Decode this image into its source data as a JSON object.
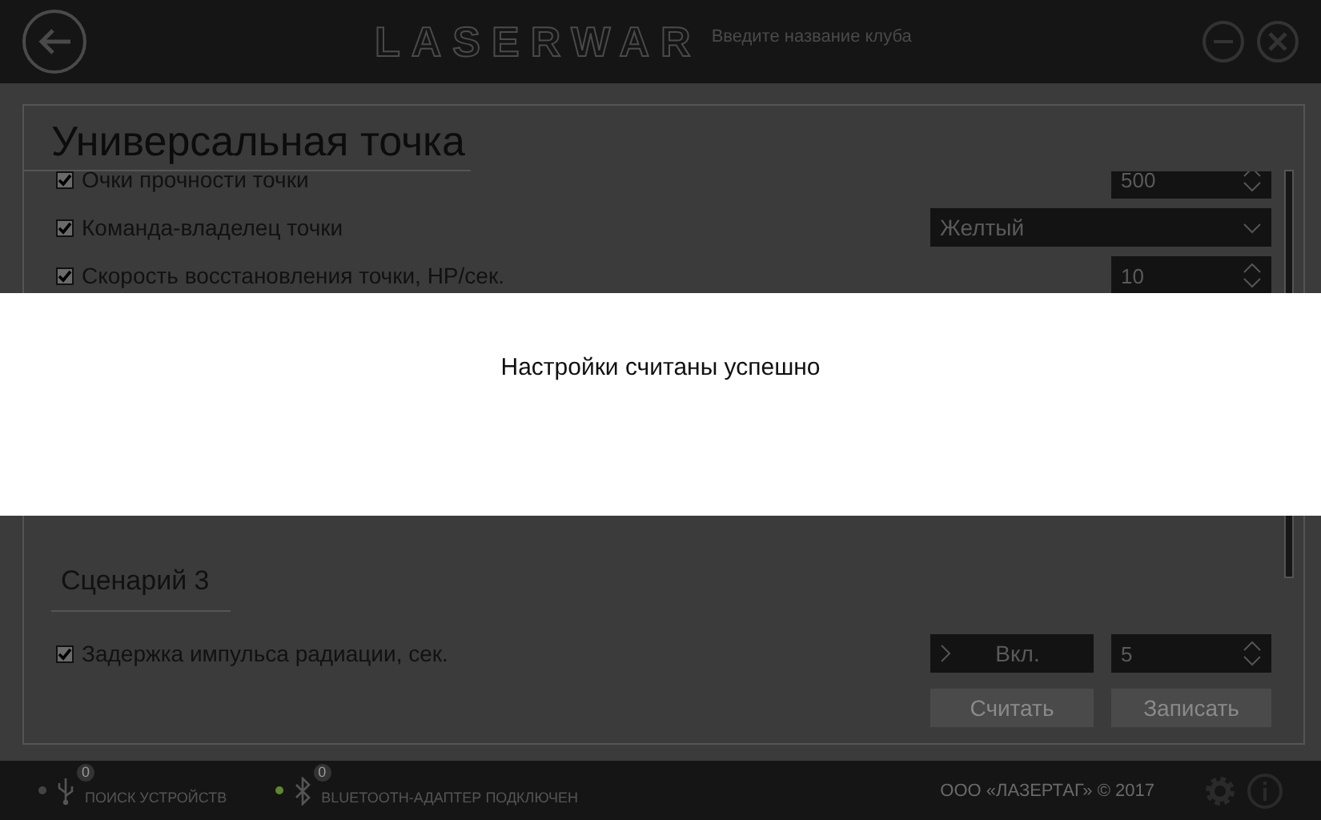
{
  "header": {
    "logo": "LASERWAR",
    "club_field": {
      "placeholder": "Введите название клуба"
    }
  },
  "panel": {
    "title": "Универсальная точка",
    "settings": [
      {
        "kind": "number",
        "label": "Очки прочности точки",
        "checked": true,
        "value": "500"
      },
      {
        "kind": "select",
        "label": "Команда-владелец точки",
        "checked": true,
        "value": "Желтый"
      },
      {
        "kind": "number",
        "label": "Скорость восстановления точки, HP/сек.",
        "checked": true,
        "value": "10"
      }
    ],
    "section": {
      "title": "Сценарий 3",
      "settings": [
        {
          "kind": "toggle_number",
          "label": "Задержка импульса радиации, сек.",
          "checked": true,
          "toggle": "Вкл.",
          "value": "5"
        }
      ]
    },
    "buttons": [
      "Считать",
      "Записать"
    ]
  },
  "notification": {
    "message": "Настройки считаны успешно"
  },
  "status_bar": {
    "items": [
      {
        "kind": "usb",
        "label": "ПОИСК УСТРОЙСТВ",
        "connected": false,
        "count": "0"
      },
      {
        "kind": "bluetooth",
        "label": "BLUETOOTH-АДАПТЕР ПОДКЛЮЧЕН",
        "connected": true,
        "count": "0"
      }
    ],
    "copyright": "ООО «ЛАЗЕРТАГ» © 2017"
  }
}
